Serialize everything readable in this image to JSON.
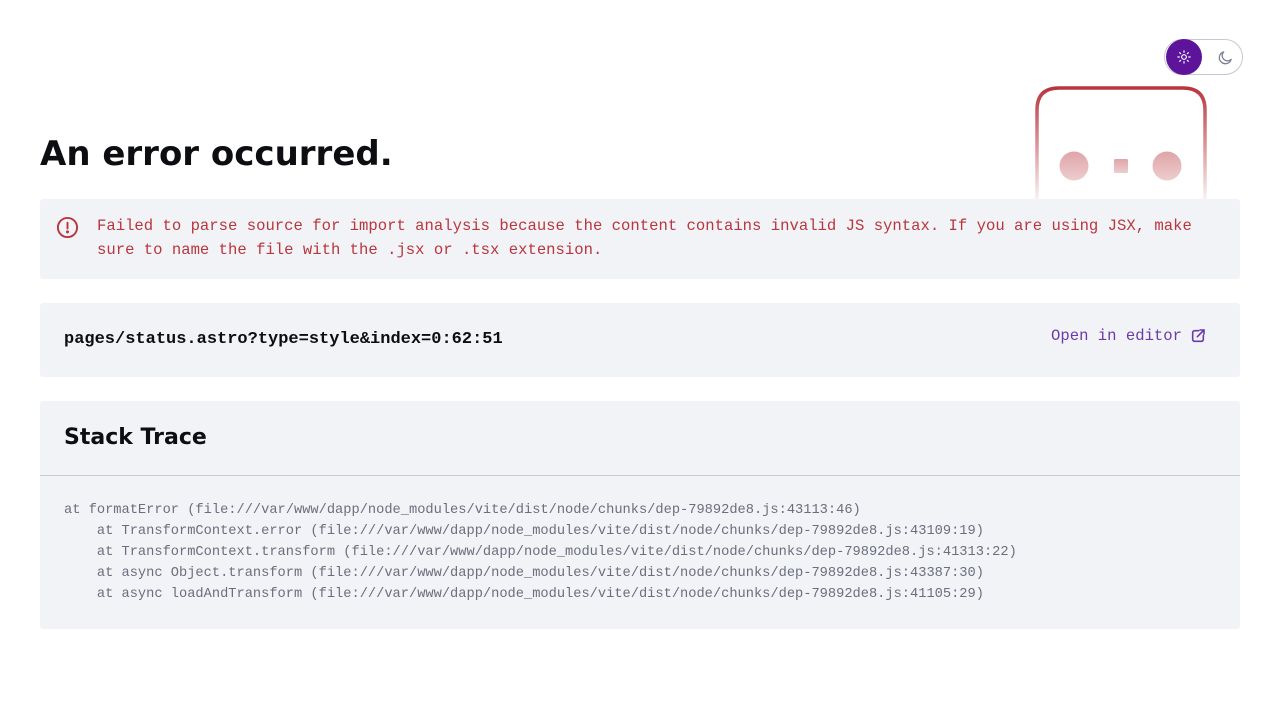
{
  "theme_toggle": {
    "light_icon": "sun-icon",
    "dark_icon": "moon-icon",
    "active": "light",
    "accent_color": "#5d149a"
  },
  "mascot": {
    "icon": "astro-error-mascot",
    "color": "#b8363d"
  },
  "header": {
    "title": "An error occurred."
  },
  "error": {
    "icon": "alert-circle-icon",
    "message": "Failed to parse source for import analysis because the content contains invalid JS syntax. If you are using JSX, make sure to name the file with the .jsx or .tsx extension.",
    "color": "#b8363d"
  },
  "file": {
    "path": "pages/status.astro?type=style&index=0:62:51",
    "open_editor_label": "Open in editor",
    "open_editor_icon": "external-link-icon",
    "link_color": "#6a3aa8"
  },
  "stack": {
    "title": "Stack Trace",
    "lines": [
      "at formatError (file:///var/www/dapp/node_modules/vite/dist/node/chunks/dep-79892de8.js:43113:46)",
      "    at TransformContext.error (file:///var/www/dapp/node_modules/vite/dist/node/chunks/dep-79892de8.js:43109:19)",
      "    at TransformContext.transform (file:///var/www/dapp/node_modules/vite/dist/node/chunks/dep-79892de8.js:41313:22)",
      "    at async Object.transform (file:///var/www/dapp/node_modules/vite/dist/node/chunks/dep-79892de8.js:43387:30)",
      "    at async loadAndTransform (file:///var/www/dapp/node_modules/vite/dist/node/chunks/dep-79892de8.js:41105:29)"
    ]
  }
}
